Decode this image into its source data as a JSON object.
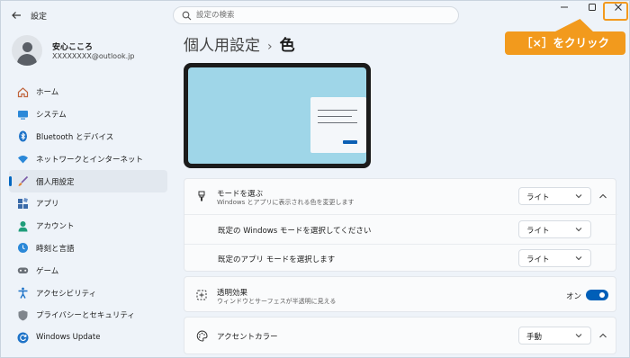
{
  "window": {
    "app_title": "設定",
    "back_icon": "arrow-left-icon",
    "search_placeholder": "設定の検索"
  },
  "annotation": {
    "callout_text": "［×］をクリック",
    "color": "#f29a1d"
  },
  "profile": {
    "name": "安心こころ",
    "email": "XXXXXXXX@outlook.jp"
  },
  "sidebar": {
    "items": [
      {
        "label": "ホーム",
        "icon": "home-icon"
      },
      {
        "label": "システム",
        "icon": "monitor-icon"
      },
      {
        "label": "Bluetooth とデバイス",
        "icon": "bluetooth-icon"
      },
      {
        "label": "ネットワークとインターネット",
        "icon": "wifi-icon"
      },
      {
        "label": "個人用設定",
        "icon": "brush-icon",
        "active": true
      },
      {
        "label": "アプリ",
        "icon": "apps-icon"
      },
      {
        "label": "アカウント",
        "icon": "person-icon"
      },
      {
        "label": "時刻と言語",
        "icon": "globe-clock-icon"
      },
      {
        "label": "ゲーム",
        "icon": "gamepad-icon"
      },
      {
        "label": "アクセシビリティ",
        "icon": "accessibility-icon"
      },
      {
        "label": "プライバシーとセキュリティ",
        "icon": "shield-icon"
      },
      {
        "label": "Windows Update",
        "icon": "update-icon"
      }
    ]
  },
  "breadcrumb": {
    "parent": "個人用設定",
    "separator": "›",
    "current": "色"
  },
  "mode": {
    "title": "モードを選ぶ",
    "subtitle": "Windows とアプリに表示される色を変更します",
    "value": "ライト",
    "windows_label": "既定の Windows モードを選択してください",
    "windows_value": "ライト",
    "app_label": "既定のアプリ モードを選択します",
    "app_value": "ライト"
  },
  "transparency": {
    "title": "透明効果",
    "subtitle": "ウィンドウとサーフェスが半透明に見える",
    "state_label": "オン",
    "on": true
  },
  "accent": {
    "title": "アクセントカラー",
    "value": "手動"
  },
  "colors": {
    "accent": "#005fb8",
    "preview_sky": "#9fd6e8"
  }
}
